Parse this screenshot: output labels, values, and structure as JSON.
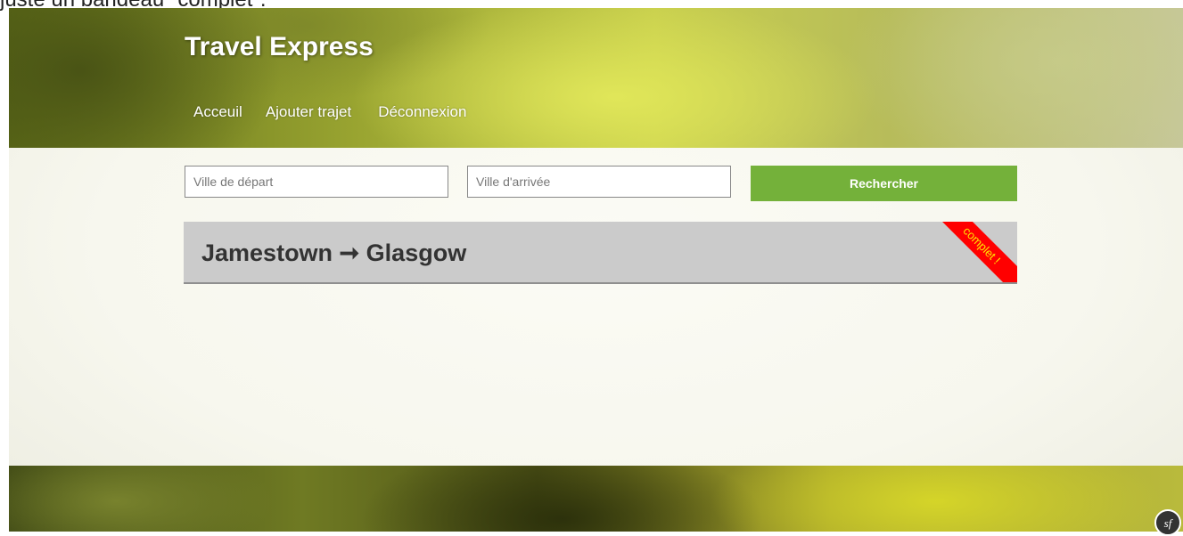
{
  "caption": "juste un bandeau \"complet\".",
  "header": {
    "brand": "Travel Express",
    "nav": [
      "Acceuil",
      "Ajouter trajet",
      "Déconnexion"
    ]
  },
  "search": {
    "from_placeholder": "Ville de départ",
    "to_placeholder": "Ville d'arrivée",
    "button_label": "Rechercher"
  },
  "trips": [
    {
      "title": "Jamestown ➞ Glasgow",
      "badge": "complet !"
    }
  ],
  "colors": {
    "accent": "#74b13a",
    "ribbon_bg": "#ff0000",
    "ribbon_text": "#ffe400",
    "card_bg": "#cbcbcb"
  },
  "icons": {
    "debug_toolbar": "symfony-icon"
  },
  "debug_toolbar": {
    "label": "sf"
  }
}
